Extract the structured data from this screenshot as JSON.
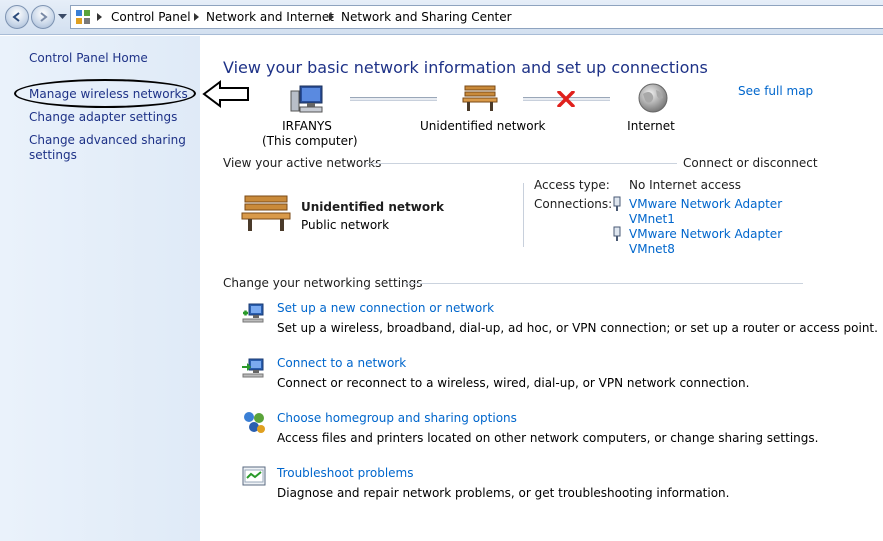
{
  "breadcrumb": [
    "Control Panel",
    "Network and Internet",
    "Network and Sharing Center"
  ],
  "left_pane": {
    "home": "Control Panel Home",
    "items": [
      "Manage wireless networks",
      "Change adapter settings",
      "Change advanced sharing settings"
    ]
  },
  "main": {
    "title": "View your basic network information and set up connections",
    "see_full_map": "See full map",
    "map": {
      "computer_name": "IRFANYS",
      "computer_sub": "(This computer)",
      "network": "Unidentified network",
      "internet": "Internet"
    },
    "active": {
      "heading": "View your active networks",
      "connect_link": "Connect or disconnect",
      "network_name": "Unidentified network",
      "network_type": "Public network",
      "access_type_label": "Access type:",
      "access_type_value": "No Internet access",
      "connections_label": "Connections:",
      "connections": [
        {
          "line1": "VMware Network Adapter",
          "line2": "VMnet1"
        },
        {
          "line1": "VMware Network Adapter",
          "line2": "VMnet8"
        }
      ]
    },
    "settings": {
      "heading": "Change your networking settings",
      "tasks": [
        {
          "title": "Set up a new connection or network",
          "desc": "Set up a wireless, broadband, dial-up, ad hoc, or VPN connection; or set up a router or access point."
        },
        {
          "title": "Connect to a network",
          "desc": "Connect or reconnect to a wireless, wired, dial-up, or VPN network connection."
        },
        {
          "title": "Choose homegroup and sharing options",
          "desc": "Access files and printers located on other network computers, or change sharing settings."
        },
        {
          "title": "Troubleshoot problems",
          "desc": "Diagnose and repair network problems, or get troubleshooting information."
        }
      ]
    }
  },
  "icons": {
    "back": "back-arrow-icon",
    "forward": "forward-arrow-icon",
    "computer": "computer-icon",
    "bench": "park-bench-icon",
    "globe": "globe-icon",
    "disconnect": "red-x-icon",
    "adapter": "network-adapter-icon"
  },
  "colors": {
    "link": "#0066cc",
    "title": "#1e3287",
    "left_pane": "#e4edf8",
    "disconnect": "#e0201c"
  }
}
